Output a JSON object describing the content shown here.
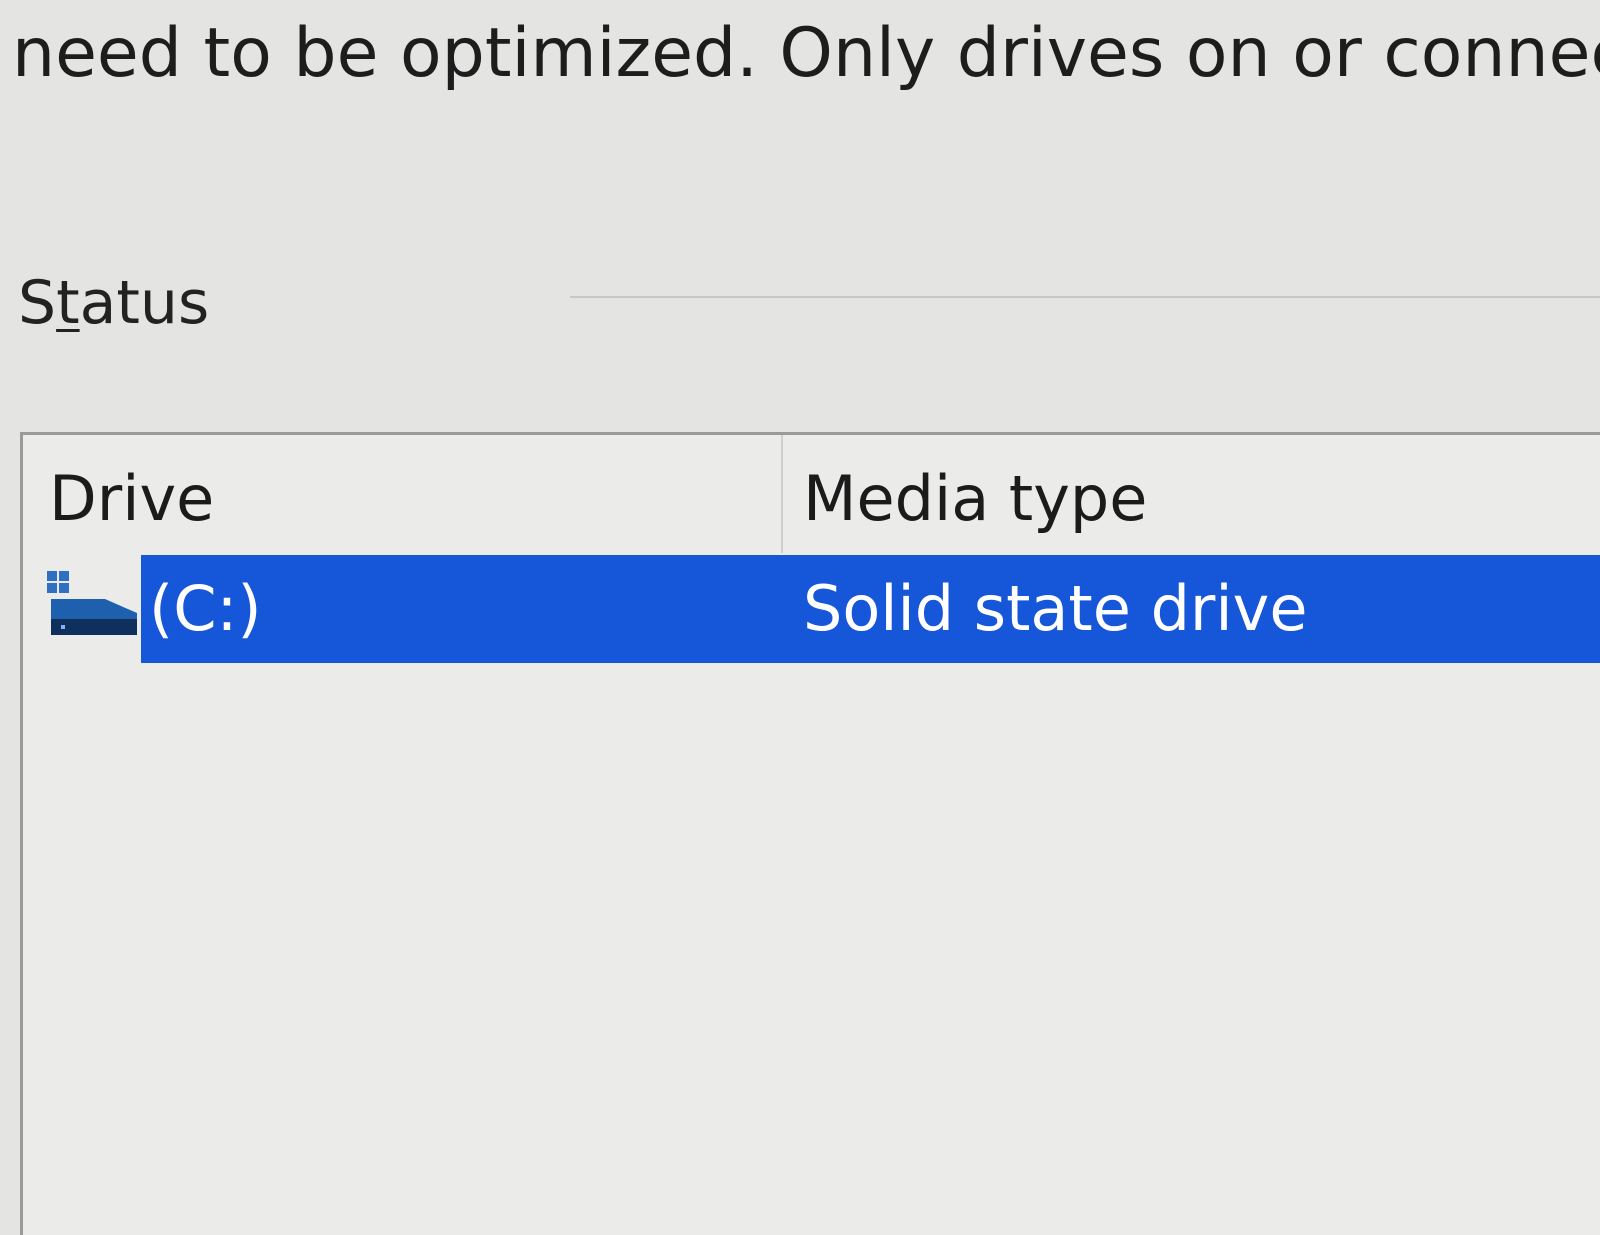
{
  "description": "need to be optimized. Only drives on or connec",
  "status": {
    "label_accel_lead": "S",
    "label_accel_char": "t",
    "label_rest": "atus"
  },
  "drive_list": {
    "columns": [
      "Drive",
      "Media type"
    ],
    "rows": [
      {
        "drive": "(C:)",
        "media_type": "Solid state drive",
        "icon": "windows-drive-icon",
        "selected": true
      }
    ]
  },
  "colors": {
    "selection": "#1656d8",
    "background": "#e4e4e2",
    "drive_icon": "#1e5fae"
  }
}
